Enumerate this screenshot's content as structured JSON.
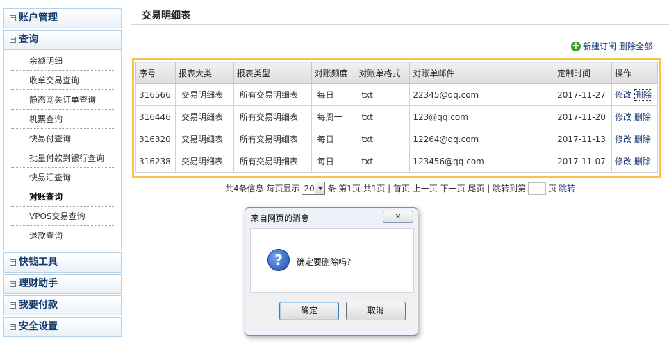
{
  "sidebar": {
    "sections": [
      {
        "title": "账户管理",
        "toggle": "+"
      },
      {
        "title": "查询",
        "toggle": "−"
      },
      {
        "title": "快钱工具",
        "toggle": "+"
      },
      {
        "title": "理财助手",
        "toggle": "+"
      },
      {
        "title": "我要付款",
        "toggle": "+"
      },
      {
        "title": "安全设置",
        "toggle": "+"
      }
    ],
    "query_items": [
      "余额明细",
      "收单交易查询",
      "静态网关订单查询",
      "机票查询",
      "快易付查询",
      "批量付款到银行查询",
      "快易汇查询",
      "对账查询",
      "VPOS交易查询",
      "退款查询"
    ],
    "active_item": "对账查询"
  },
  "page": {
    "title": "交易明细表",
    "new_subscription": "新建订阅",
    "delete_all": "删除全部"
  },
  "table": {
    "headers": [
      "序号",
      "报表大类",
      "报表类型",
      "对账频度",
      "对账单格式",
      "对账单邮件",
      "定制时间",
      "操作"
    ],
    "rows": [
      [
        "316566",
        "交易明细表",
        "所有交易明细表",
        "每日",
        "txt",
        "22345@qq.com",
        "2017-11-27"
      ],
      [
        "316446",
        "交易明细表",
        "所有交易明细表",
        "每周一",
        "txt",
        "123@qq.com",
        "2017-11-20"
      ],
      [
        "316320",
        "交易明细表",
        "所有交易明细表",
        "每日",
        "txt",
        "12264@qq.com",
        "2017-11-13"
      ],
      [
        "316238",
        "交易明细表",
        "所有交易明细表",
        "每日",
        "txt",
        "123456@qq.com",
        "2017-11-07"
      ]
    ],
    "edit_label": "修改",
    "delete_label": "删除"
  },
  "pager": {
    "prefix": "共4条信息 每页显示",
    "page_size": "20",
    "suffix": "条 第1页 共1页 | 首页 上一页 下一页 尾页 | 跳转到第",
    "page_unit": "页",
    "jump": "跳转"
  },
  "dialog": {
    "title": "来自网页的消息",
    "close": "✕",
    "message": "确定要删除吗？",
    "ok": "确定",
    "cancel": "取消"
  },
  "colors": {
    "table_highlight": "#f7c44a",
    "link": "#1e3a7a",
    "sidebar_header_text": "#123a6b"
  }
}
